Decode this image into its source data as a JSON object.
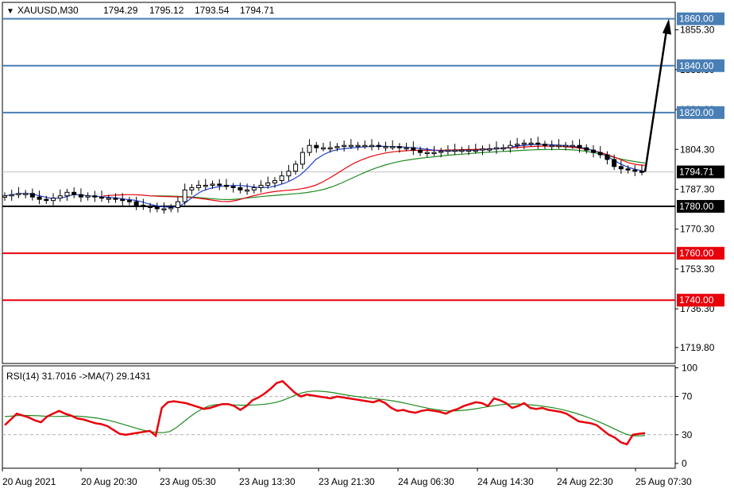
{
  "header": {
    "menu_glyph": "▼",
    "symbol": "XAUUSD,M30",
    "open": "1794.29",
    "high": "1795.12",
    "low": "1793.54",
    "close": "1794.71"
  },
  "rsi_header": {
    "label": "RSI(14) 31.7016  ->MA(7) 29.1431"
  },
  "chart_data": [
    {
      "type": "candlestick",
      "title": "XAUUSD,M30",
      "ylim": [
        1713,
        1867
      ],
      "y_ticks": [
        "1855.30",
        "1838.30",
        "1821.30",
        "1804.30",
        "1787.30",
        "1770.30",
        "1753.30",
        "1736.30",
        "1719.80"
      ],
      "x_ticks": [
        "20 Aug 2021",
        "20 Aug 20:30",
        "23 Aug 05:30",
        "23 Aug 13:30",
        "23 Aug 21:30",
        "24 Aug 06:30",
        "24 Aug 14:30",
        "24 Aug 22:30",
        "25 Aug 07:30"
      ],
      "current_price": {
        "value": 1794.71,
        "label": "1794.71"
      },
      "levels": [
        {
          "value": 1860,
          "label": "1860.00",
          "color": "#4a7fb5"
        },
        {
          "value": 1840,
          "label": "1840.00",
          "color": "#4a7fb5"
        },
        {
          "value": 1820,
          "label": "1820.00",
          "color": "#4a7fb5"
        },
        {
          "value": 1780,
          "label": "1780.00",
          "color": "#000000"
        },
        {
          "value": 1760,
          "label": "1760.00",
          "color": "#e8000b"
        },
        {
          "value": 1740,
          "label": "1740.00",
          "color": "#e8000b"
        }
      ],
      "close_series": [
        1784.5,
        1785,
        1785.5,
        1785.5,
        1784,
        1783,
        1782.5,
        1783.5,
        1784.5,
        1786,
        1785,
        1784,
        1784.5,
        1784,
        1783.5,
        1783.5,
        1783,
        1782.5,
        1782,
        1780.5,
        1780,
        1779.5,
        1779,
        1779,
        1779.5,
        1782,
        1787,
        1788,
        1789,
        1789,
        1789.5,
        1789,
        1788.5,
        1788,
        1787,
        1787,
        1788,
        1789,
        1790,
        1791,
        1793,
        1795,
        1798,
        1803,
        1806,
        1805,
        1805,
        1805,
        1805.5,
        1806,
        1806,
        1806,
        1806,
        1806,
        1805.5,
        1805.5,
        1805.5,
        1805,
        1805,
        1804,
        1803,
        1803,
        1803,
        1803.5,
        1804,
        1804,
        1804,
        1804,
        1804,
        1804.5,
        1804.5,
        1805,
        1805,
        1806,
        1806.5,
        1807,
        1807,
        1806.5,
        1806,
        1806,
        1806,
        1806,
        1806,
        1805,
        1804,
        1803,
        1802,
        1800,
        1797,
        1796,
        1795.5,
        1795,
        1794.71
      ],
      "ema_fast": [
        1784.5,
        1785,
        1785.5,
        1785.5,
        1785,
        1784.2,
        1783.5,
        1783.5,
        1784,
        1785,
        1785,
        1784.5,
        1784.3,
        1784,
        1783.8,
        1783.5,
        1783,
        1782.7,
        1782,
        1781,
        1780.3,
        1779.8,
        1779.6,
        1780,
        1782,
        1784.5,
        1786.5,
        1787.6,
        1788.3,
        1788.7,
        1788.9,
        1788.9,
        1788.6,
        1788.2,
        1788,
        1788.2,
        1789,
        1790,
        1791.5,
        1793.5,
        1796.5,
        1800,
        1802,
        1803.5,
        1804.3,
        1804.7,
        1805,
        1805.3,
        1805.5,
        1805.6,
        1805.6,
        1805.5,
        1805.4,
        1805.2,
        1805,
        1804.6,
        1804.2,
        1803.8,
        1803.6,
        1803.6,
        1803.7,
        1803.8,
        1803.9,
        1804.1,
        1804.4,
        1804.7,
        1805,
        1805.4,
        1805.9,
        1806.2,
        1806.4,
        1806.4,
        1806.3,
        1806.1,
        1805.9,
        1805.6,
        1805.1,
        1804.4,
        1803.4,
        1802,
        1800.3,
        1798.4,
        1796.9,
        1795.9,
        1795.2
      ],
      "ema_slow": [
        1784.5,
        1784.7,
        1784.9,
        1785,
        1785,
        1784.8,
        1784.5,
        1784.3,
        1784.2,
        1784.1,
        1784,
        1783.8,
        1783.5,
        1783.1,
        1782.6,
        1782.1,
        1782,
        1782.6,
        1783.5,
        1784.4,
        1785.2,
        1785.9,
        1786.4,
        1786.7,
        1787,
        1787.4,
        1788,
        1789,
        1790.5,
        1792.4,
        1794.5,
        1796.6,
        1798.5,
        1800,
        1801.2,
        1802.1,
        1802.8,
        1803.3,
        1803.6,
        1803.8,
        1803.9,
        1803.9,
        1803.9,
        1803.9,
        1804,
        1804.1,
        1804.2,
        1804.3,
        1804.4,
        1804.5,
        1804.6,
        1804.8,
        1805,
        1805.2,
        1805.4,
        1805.6,
        1805.7,
        1805.7,
        1805.6,
        1805.4,
        1805.1,
        1804.7,
        1804.1,
        1803.3,
        1802.3,
        1801.1,
        1799.8,
        1798.5,
        1797.8,
        1797.5
      ],
      "sma_slow": [
        1784.5,
        1784.5,
        1784.4,
        1784.3,
        1784.1,
        1783.9,
        1783.6,
        1783.3,
        1783,
        1782.9,
        1783.1,
        1783.5,
        1783.9,
        1784.3,
        1784.6,
        1784.9,
        1785.2,
        1785.5,
        1785.9,
        1786.5,
        1787.3,
        1788.5,
        1790,
        1791.7,
        1793.4,
        1795,
        1796.4,
        1797.6,
        1798.6,
        1799.4,
        1800,
        1800.5,
        1800.9,
        1801.3,
        1801.7,
        1802,
        1802.3,
        1802.6,
        1802.9,
        1803.1,
        1803.3,
        1803.5,
        1803.7,
        1803.9,
        1804.1,
        1804.2,
        1804.3,
        1804.3,
        1804.2,
        1804,
        1803.6,
        1803,
        1802.2,
        1801.3,
        1800.4,
        1799.6,
        1799,
        1798.5
      ],
      "target_arrow": {
        "from": 1794.71,
        "to": 1860
      }
    },
    {
      "type": "line",
      "title": "RSI(14) 31.7016  ->MA(7) 29.1431",
      "ylim": [
        -5,
        102
      ],
      "y_ticks": [
        "100",
        "70",
        "30",
        "0"
      ],
      "levels": [
        70,
        30
      ],
      "series": [
        {
          "name": "RSI(14)",
          "color": "#e8000b",
          "values": [
            40,
            46,
            52,
            50,
            48,
            45,
            43,
            49,
            52,
            55,
            52,
            50,
            47,
            46,
            44,
            42,
            41,
            39,
            35,
            31,
            30,
            31,
            32,
            33,
            34,
            29,
            58,
            64,
            65,
            64,
            63,
            61,
            59,
            57,
            58,
            60,
            62,
            62,
            60,
            56,
            60,
            66,
            69,
            73,
            78,
            84,
            86,
            80,
            74,
            70,
            72,
            71,
            70,
            69,
            68,
            70,
            69,
            68,
            67,
            66,
            65,
            64,
            66,
            63,
            58,
            55,
            56,
            54,
            53,
            55,
            56,
            55,
            54,
            52,
            55,
            57,
            60,
            62,
            64,
            63,
            60,
            68,
            66,
            63,
            58,
            60,
            63,
            58,
            57,
            58,
            56,
            55,
            54,
            52,
            48,
            44,
            43,
            42,
            40,
            35,
            30,
            27,
            22,
            20,
            30,
            31,
            31.7
          ]
        },
        {
          "name": "MA(7)",
          "color": "#1f8a1f",
          "values": [
            49,
            49.5,
            50,
            50.2,
            50.1,
            49.8,
            49.4,
            49.2,
            49.1,
            49.3,
            49.5,
            49.4,
            48.9,
            48.2,
            47.3,
            46.1,
            44.6,
            42.8,
            40.8,
            38.7,
            36.6,
            34.8,
            33.3,
            32.4,
            32.2,
            33.3,
            37.5,
            43,
            48.5,
            53.4,
            57.4,
            60.3,
            61.5,
            61.7,
            61.5,
            61.1,
            60.9,
            61,
            61.2,
            61.6,
            62.4,
            63.7,
            65.7,
            68.3,
            71.2,
            73.7,
            75.2,
            75.7,
            75.4,
            74.7,
            73.7,
            72.5,
            71.2,
            70.2,
            69.3,
            68.5,
            67.7,
            67,
            66.2,
            65.2,
            63.9,
            62.4,
            60.9,
            59.4,
            57.9,
            56.6,
            55.6,
            55,
            54.9,
            55.2,
            55.9,
            56.8,
            57.9,
            59.1,
            60.2,
            61.2,
            62,
            62.3,
            62.1,
            61.6,
            61,
            60.3,
            59.4,
            58.3,
            57,
            55.4,
            53.5,
            51.4,
            49,
            46.4,
            43.6,
            40.5,
            37.2,
            33.9,
            30.9,
            29,
            28.8,
            29.1431
          ]
        }
      ]
    }
  ]
}
